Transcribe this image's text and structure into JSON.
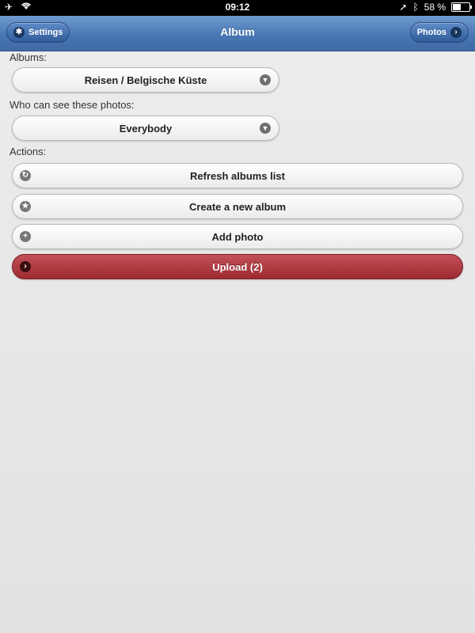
{
  "status": {
    "time": "09:12",
    "battery": "58 %",
    "battery_level": 0.58,
    "icons": [
      "airplane-icon",
      "wifi-icon",
      "location-arrow-icon",
      "bluetooth-icon",
      "battery-icon"
    ]
  },
  "navbar": {
    "title": "Album",
    "left_button": "Settings",
    "right_button": "Photos"
  },
  "form": {
    "albums_label": "Albums:",
    "album_value": "Reisen / Belgische Küste",
    "visibility_label": "Who can see these photos:",
    "visibility_value": "Everybody",
    "actions_label": "Actions:"
  },
  "actions": [
    {
      "label": "Refresh albums list",
      "icon": "refresh-icon"
    },
    {
      "label": "Create a new album",
      "icon": "star-icon"
    },
    {
      "label": "Add photo",
      "icon": "plus-icon"
    },
    {
      "label": "Upload (2)",
      "icon": "arrow-right-icon"
    }
  ],
  "colors": {
    "navbar": "#4a77b5",
    "upload_button": "#b03c43"
  }
}
